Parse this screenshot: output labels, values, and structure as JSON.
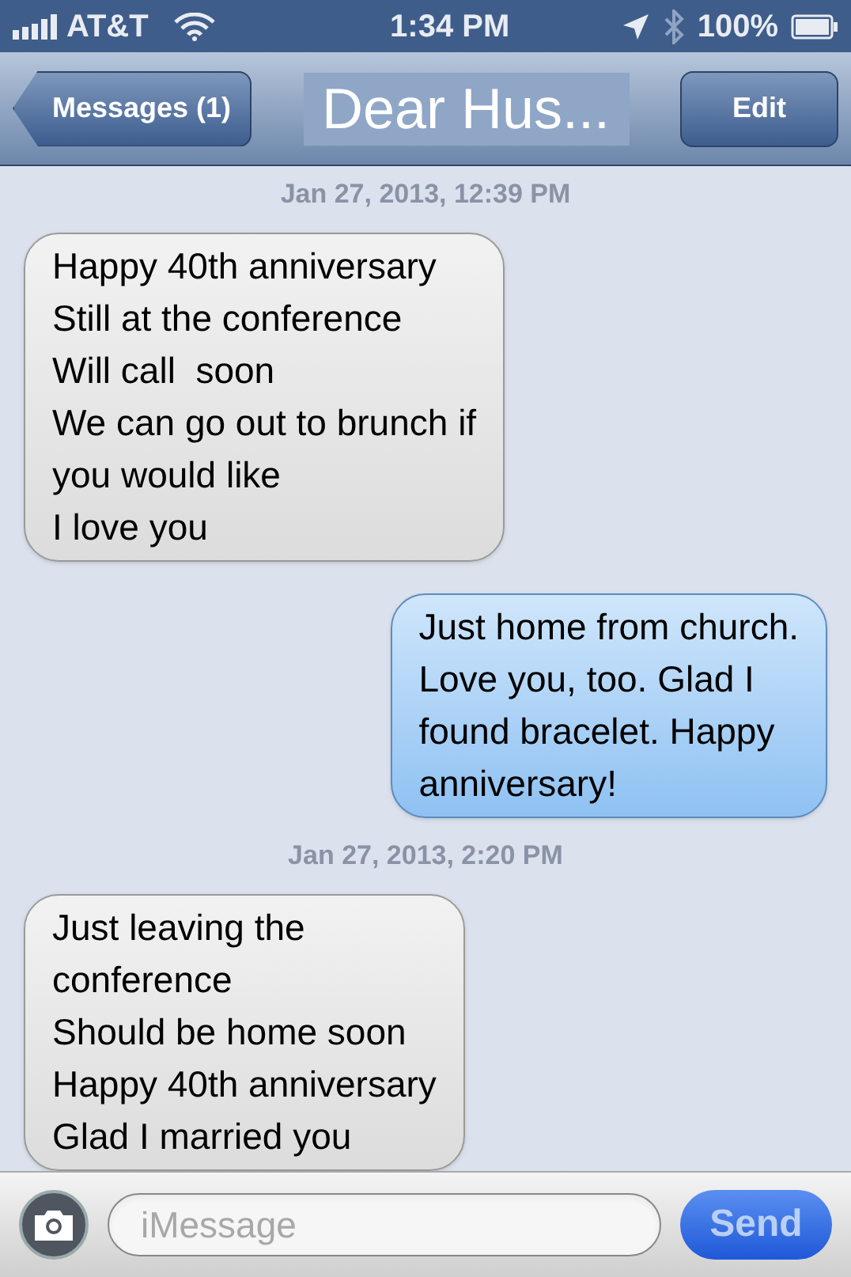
{
  "status_bar": {
    "carrier": "AT&T",
    "time": "1:34 PM",
    "battery": "100%"
  },
  "nav_bar": {
    "back": "Messages (1)",
    "title": "Dear Hus...",
    "edit": "Edit"
  },
  "items": [
    {
      "kind": "timestamp",
      "text": "Jan 27, 2013, 12:39 PM"
    },
    {
      "kind": "received",
      "text": "Happy 40th anniversary\nStill at the conference\nWill call  soon\nWe can go out to brunch if\nyou would like\nI love you"
    },
    {
      "kind": "sent",
      "text": "Just home from church.\nLove you, too. Glad I\nfound bracelet. Happy\nanniversary!"
    },
    {
      "kind": "timestamp",
      "text": "Jan 27, 2013, 2:20 PM"
    },
    {
      "kind": "received",
      "text": "Just leaving the\nconference\nShould be home soon\nHappy 40th anniversary\nGlad I married you"
    }
  ],
  "compose": {
    "placeholder": "iMessage",
    "send": "Send"
  }
}
